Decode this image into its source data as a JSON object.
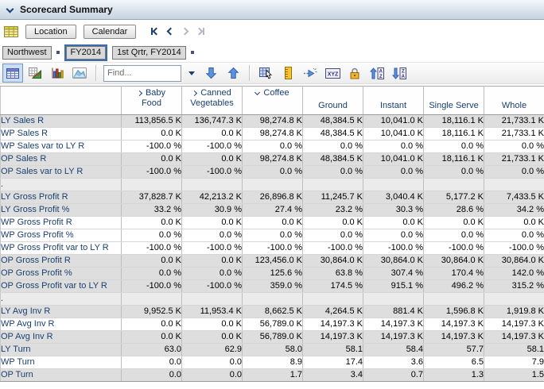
{
  "panel": {
    "title": "Scorecard Summary"
  },
  "page_bar": {
    "layout_icon": "pivot-layout-grid",
    "tabs": [
      {
        "label": "Location"
      },
      {
        "label": "Calendar"
      }
    ],
    "nav": [
      {
        "name": "first-page",
        "enabled": true
      },
      {
        "name": "previous-page",
        "enabled": true
      },
      {
        "name": "next-page",
        "enabled": false
      },
      {
        "name": "last-page",
        "enabled": false
      }
    ]
  },
  "filters": {
    "items": [
      {
        "label": "Northwest",
        "selected": false,
        "group_end": true
      },
      {
        "label": "FY2014",
        "selected": true,
        "group_end": false
      },
      {
        "label": "1st Qrtr, FY2014",
        "selected": false,
        "group_end": true
      }
    ]
  },
  "toolbar": {
    "view_icons": [
      {
        "name": "pivot-view",
        "selected": true
      },
      {
        "name": "grid-chart-view",
        "selected": false
      },
      {
        "name": "bar-chart-view",
        "selected": false
      },
      {
        "name": "area-chart-view",
        "selected": false
      }
    ],
    "find": {
      "placeholder": "Find..."
    },
    "action_icons": [
      "find-next",
      "find-previous",
      "select-region",
      "ruler",
      "drill",
      "xyz-labels",
      "lock",
      "sort-ascending",
      "sort-descending"
    ],
    "xyz_glyph": "XYZ",
    "sort_asc_top": "A",
    "sort_asc_bottom": "Z",
    "sort_desc_top": "Z",
    "sort_desc_bottom": "A"
  },
  "colors": {
    "accent_blue": "#3a6cb2",
    "header_text": "#1a4070",
    "row_gray": "#dedede",
    "row_separator": "#ebebeb",
    "titlebar_gradient_bottom": "#c7d4e2"
  },
  "table": {
    "columns": [
      {
        "label": "Baby Food",
        "state": "collapsed"
      },
      {
        "label": "Canned Vegetables",
        "state": "collapsed"
      },
      {
        "label": "Coffee",
        "state": "expanded"
      },
      {
        "label": "Ground",
        "state": "leaf"
      },
      {
        "label": "Instant",
        "state": "leaf"
      },
      {
        "label": "Single Serve",
        "state": "leaf"
      },
      {
        "label": "Whole",
        "state": "leaf"
      }
    ],
    "rows": [
      {
        "label": "LY Sales R",
        "shade": "g",
        "values": [
          "113,856.5 K",
          "136,747.3 K",
          "98,274.8 K",
          "48,384.5 K",
          "10,041.0 K",
          "18,116.1 K",
          "21,733.1 K"
        ]
      },
      {
        "label": "WP Sales R",
        "shade": "w",
        "values": [
          "0.0 K",
          "0.0 K",
          "98,274.8 K",
          "48,384.5 K",
          "10,041.0 K",
          "18,116.1 K",
          "21,733.1 K"
        ]
      },
      {
        "label": "WP Sales var to LY R",
        "shade": "w",
        "values": [
          "-100.0 %",
          "-100.0 %",
          "0.0 %",
          "0.0 %",
          "0.0 %",
          "0.0 %",
          "0.0 %"
        ]
      },
      {
        "label": "OP Sales R",
        "shade": "g",
        "values": [
          "0.0 K",
          "0.0 K",
          "98,274.8 K",
          "48,384.5 K",
          "10,041.0 K",
          "18,116.1 K",
          "21,733.1 K"
        ]
      },
      {
        "label": "OP Sales var to LY R",
        "shade": "g",
        "values": [
          "-100.0 %",
          "-100.0 %",
          "0.0 %",
          "0.0 %",
          "0.0 %",
          "0.0 %",
          "0.0 %"
        ]
      },
      {
        "label": ".",
        "shade": "s",
        "values": [
          "",
          "",
          "",
          "",
          "",
          "",
          ""
        ]
      },
      {
        "label": "LY Gross Profit R",
        "shade": "g",
        "values": [
          "37,828.7 K",
          "42,213.2 K",
          "26,896.8 K",
          "11,245.7 K",
          "3,040.4 K",
          "5,177.2 K",
          "7,433.5 K"
        ]
      },
      {
        "label": "LY Gross Profit %",
        "shade": "g",
        "values": [
          "33.2 %",
          "30.9 %",
          "27.4 %",
          "23.2 %",
          "30.3 %",
          "28.6 %",
          "34.2 %"
        ]
      },
      {
        "label": "WP Gross Profit R",
        "shade": "w",
        "values": [
          "0.0 K",
          "0.0 K",
          "0.0 K",
          "0.0 K",
          "0.0 K",
          "0.0 K",
          "0.0 K"
        ]
      },
      {
        "label": "WP Gross Profit %",
        "shade": "w",
        "values": [
          "0.0 %",
          "0.0 %",
          "0.0 %",
          "0.0 %",
          "0.0 %",
          "0.0 %",
          "0.0 %"
        ]
      },
      {
        "label": "WP Gross Profit var to LY R",
        "shade": "w",
        "values": [
          "-100.0 %",
          "-100.0 %",
          "-100.0 %",
          "-100.0 %",
          "-100.0 %",
          "-100.0 %",
          "-100.0 %"
        ]
      },
      {
        "label": "OP Gross Profit R",
        "shade": "g",
        "values": [
          "0.0 K",
          "0.0 K",
          "123,456.0 K",
          "30,864.0 K",
          "30,864.0 K",
          "30,864.0 K",
          "30,864.0 K"
        ]
      },
      {
        "label": "OP Gross Profit %",
        "shade": "g",
        "values": [
          "0.0 %",
          "0.0 %",
          "125.6 %",
          "63.8 %",
          "307.4 %",
          "170.4 %",
          "142.0 %"
        ]
      },
      {
        "label": "OP Gross Profit var to LY R",
        "shade": "g",
        "values": [
          "-100.0 %",
          "-100.0 %",
          "359.0 %",
          "174.5 %",
          "915.1 %",
          "496.2 %",
          "315.2 %"
        ]
      },
      {
        "label": ".",
        "shade": "s",
        "values": [
          "",
          "",
          "",
          "",
          "",
          "",
          ""
        ]
      },
      {
        "label": "LY Avg Inv R",
        "shade": "g",
        "values": [
          "9,952.5 K",
          "11,953.4 K",
          "8,662.5 K",
          "4,264.5 K",
          "881.4 K",
          "1,596.8 K",
          "1,919.8 K"
        ]
      },
      {
        "label": "WP Avg Inv R",
        "shade": "w",
        "values": [
          "0.0 K",
          "0.0 K",
          "56,789.0 K",
          "14,197.3 K",
          "14,197.3 K",
          "14,197.3 K",
          "14,197.3 K"
        ]
      },
      {
        "label": "OP Avg Inv R",
        "shade": "g",
        "values": [
          "0.0 K",
          "0.0 K",
          "56,789.0 K",
          "14,197.3 K",
          "14,197.3 K",
          "14,197.3 K",
          "14,197.3 K"
        ]
      },
      {
        "label": "LY Turn",
        "shade": "g",
        "values": [
          "63.0",
          "62.9",
          "58.0",
          "58.1",
          "58.4",
          "57.7",
          "58.1"
        ]
      },
      {
        "label": "WP Turn",
        "shade": "w",
        "values": [
          "0.0",
          "0.0",
          "8.9",
          "17.4",
          "3.6",
          "6.5",
          "7.9"
        ]
      },
      {
        "label": "OP Turn",
        "shade": "g",
        "values": [
          "0.0",
          "0.0",
          "1.7",
          "3.4",
          "0.7",
          "1.3",
          "1.5"
        ]
      }
    ]
  }
}
